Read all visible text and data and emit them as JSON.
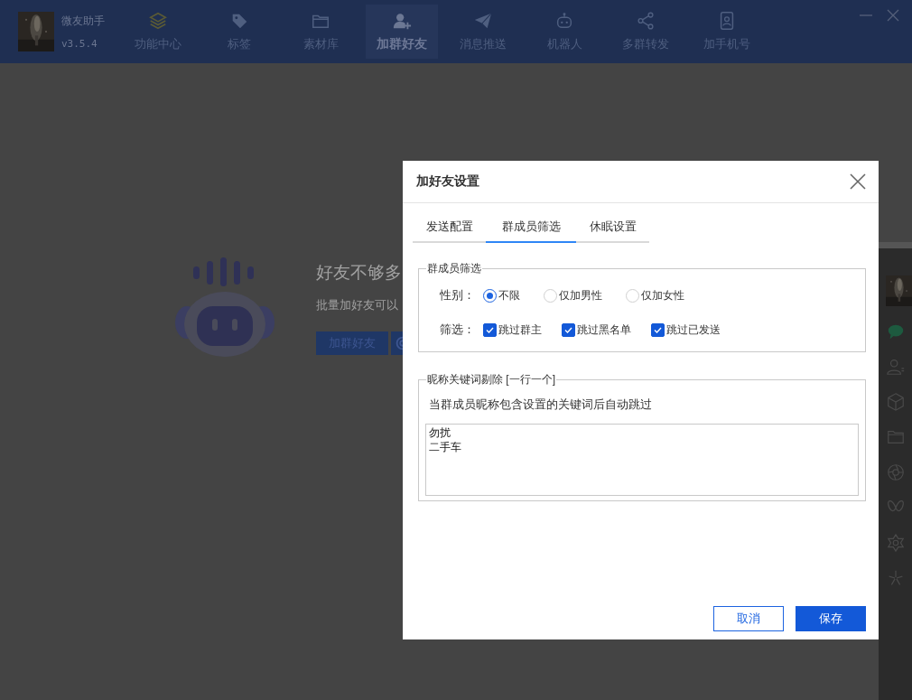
{
  "app": {
    "name": "微友助手",
    "version": "v3.5.4"
  },
  "nav": [
    {
      "label": "功能中心",
      "selected": false
    },
    {
      "label": "标签",
      "selected": false
    },
    {
      "label": "素材库",
      "selected": false
    },
    {
      "label": "加群好友",
      "selected": true
    },
    {
      "label": "消息推送",
      "selected": false
    },
    {
      "label": "机器人",
      "selected": false
    },
    {
      "label": "多群转发",
      "selected": false
    },
    {
      "label": "加手机号",
      "selected": false
    }
  ],
  "empty_state": {
    "title": "好友不够多",
    "description": "批量加好友可以",
    "buttons": [
      {
        "kind": "primary",
        "label": "加群好友"
      },
      {
        "kind": "settings"
      }
    ]
  },
  "dialog": {
    "title": "加好友设置",
    "tabs": [
      {
        "label": "发送配置",
        "selected": false
      },
      {
        "label": "群成员筛选",
        "selected": true
      },
      {
        "label": "休眠设置",
        "selected": false
      }
    ],
    "member_filter": {
      "legend": "群成员筛选",
      "gender": {
        "label": "性别：",
        "options": [
          {
            "label": "不限",
            "selected": true
          },
          {
            "label": "仅加男性",
            "selected": false
          },
          {
            "label": "仅加女性",
            "selected": false
          }
        ]
      },
      "filters": {
        "label": "筛选：",
        "options": [
          {
            "label": "跳过群主",
            "checked": true
          },
          {
            "label": "跳过黑名单",
            "checked": true
          },
          {
            "label": "跳过已发送",
            "checked": true
          }
        ]
      }
    },
    "keyword_filter": {
      "legend": "昵称关键词剔除 [一行一个]",
      "hint": "当群成员昵称包含设置的关键词后自动跳过",
      "lines": [
        "勿扰",
        "二手车"
      ]
    },
    "buttons": [
      {
        "kind": "secondary",
        "label": "取消"
      },
      {
        "kind": "primary",
        "label": "保存"
      }
    ]
  }
}
